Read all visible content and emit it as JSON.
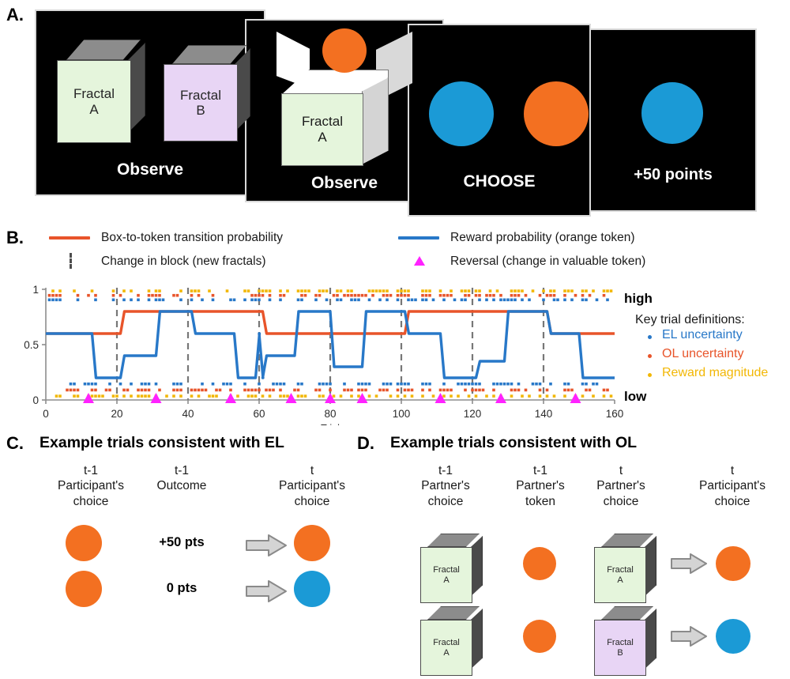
{
  "panels": {
    "a": {
      "letter": "A.",
      "screens": [
        {
          "label": "Observe",
          "cubes": [
            {
              "fractal_line1": "Fractal",
              "fractal_line2": "A",
              "face_color": "#e5f5dc"
            },
            {
              "fractal_line1": "Fractal",
              "fractal_line2": "B",
              "face_color": "#e8d5f5"
            }
          ]
        },
        {
          "label": "Observe",
          "cubes": [
            {
              "fractal_line1": "Fractal",
              "fractal_line2": "A",
              "face_color": "#e5f5dc"
            }
          ],
          "token": "orange"
        },
        {
          "label": "CHOOSE",
          "tokens": [
            "blue",
            "orange"
          ]
        },
        {
          "label": "+50 points",
          "tokens": [
            "blue"
          ]
        }
      ]
    },
    "b": {
      "letter": "B.",
      "legend": [
        {
          "id": "transition-prob",
          "type": "line",
          "color": "#e8542a",
          "label": "Box-to-token transition probability"
        },
        {
          "id": "reward-prob",
          "type": "line",
          "color": "#2878c8",
          "label": "Reward probability (orange token)"
        },
        {
          "id": "block-change",
          "type": "dash",
          "color": "#4d4d4d",
          "label": "Change in block (new fractals)"
        },
        {
          "id": "reversal",
          "type": "triangle",
          "color": "#ff22ff",
          "label": "Reversal (change in valuable token)"
        }
      ],
      "side": {
        "high": "high",
        "low": "low",
        "key_title": "Key trial definitions:",
        "items": [
          {
            "label": "EL uncertainty",
            "color": "#2878c8"
          },
          {
            "label": "OL uncertainty",
            "color": "#e8542a"
          },
          {
            "label": "Reward magnitude",
            "color": "#f2b705"
          }
        ]
      }
    },
    "c": {
      "letter": "C.",
      "title": "Example trials consistent with EL",
      "columns": [
        {
          "time": "t-1",
          "name_line1": "Participant's",
          "name_line2": "choice"
        },
        {
          "time": "t-1",
          "name_line1": "Outcome",
          "name_line2": ""
        },
        {
          "time": "t",
          "name_line1": "Participant's",
          "name_line2": "choice"
        }
      ],
      "rows": [
        {
          "prev_choice": "orange",
          "outcome": "+50 pts",
          "next_choice": "orange"
        },
        {
          "prev_choice": "orange",
          "outcome": "0 pts",
          "next_choice": "blue"
        }
      ]
    },
    "d": {
      "letter": "D.",
      "title": "Example trials consistent with OL",
      "columns": [
        {
          "time": "t-1",
          "name_line1": "Partner's",
          "name_line2": "choice"
        },
        {
          "time": "t-1",
          "name_line1": "Partner's",
          "name_line2": "token"
        },
        {
          "time": "t",
          "name_line1": "Partner's",
          "name_line2": "choice"
        },
        {
          "time": "t",
          "name_line1": "Participant's",
          "name_line2": "choice"
        }
      ],
      "rows": [
        {
          "prev_cube": {
            "fractal_line1": "Fractal",
            "fractal_line2": "A",
            "face_color": "#e5f5dc"
          },
          "prev_token": "orange",
          "cur_cube": {
            "fractal_line1": "Fractal",
            "fractal_line2": "A",
            "face_color": "#e5f5dc"
          },
          "participant_choice": "orange"
        },
        {
          "prev_cube": {
            "fractal_line1": "Fractal",
            "fractal_line2": "A",
            "face_color": "#e5f5dc"
          },
          "prev_token": "orange",
          "cur_cube": {
            "fractal_line1": "Fractal",
            "fractal_line2": "B",
            "face_color": "#e8d5f5"
          },
          "participant_choice": "blue"
        }
      ]
    }
  },
  "chart_data": {
    "type": "line",
    "title": "",
    "xlabel": "Trial",
    "ylabel": "",
    "xlim": [
      0,
      160
    ],
    "ylim": [
      0,
      1
    ],
    "xticks": [
      0,
      20,
      40,
      60,
      80,
      100,
      120,
      140,
      160
    ],
    "yticks": [
      0,
      0.5,
      1
    ],
    "grid": false,
    "legend_position": "above",
    "series": [
      {
        "name": "Box-to-token transition probability",
        "color": "#e8542a",
        "steps": [
          {
            "x": 0,
            "y": 0.6
          },
          {
            "x": 20,
            "y": 0.6
          },
          {
            "x": 21,
            "y": 0.8
          },
          {
            "x": 60,
            "y": 0.8
          },
          {
            "x": 61,
            "y": 0.6
          },
          {
            "x": 100,
            "y": 0.6
          },
          {
            "x": 101,
            "y": 0.8
          },
          {
            "x": 140,
            "y": 0.8
          },
          {
            "x": 141,
            "y": 0.6
          },
          {
            "x": 160,
            "y": 0.6
          }
        ]
      },
      {
        "name": "Reward probability (orange token)",
        "color": "#2878c8",
        "steps": [
          {
            "x": 0,
            "y": 0.6
          },
          {
            "x": 11,
            "y": 0.6
          },
          {
            "x": 13,
            "y": 0.2
          },
          {
            "x": 20,
            "y": 0.2
          },
          {
            "x": 21,
            "y": 0.4
          },
          {
            "x": 30,
            "y": 0.4
          },
          {
            "x": 31,
            "y": 0.8
          },
          {
            "x": 40,
            "y": 0.8
          },
          {
            "x": 41,
            "y": 0.6
          },
          {
            "x": 51,
            "y": 0.6
          },
          {
            "x": 52,
            "y": 0.6
          },
          {
            "x": 59,
            "y": 0.6
          },
          {
            "x": 53,
            "y": 0.2
          },
          {
            "x": 60,
            "y": 0.2
          },
          {
            "x": 61,
            "y": 0.4
          },
          {
            "x": 69,
            "y": 0.4
          },
          {
            "x": 70,
            "y": 0.8
          },
          {
            "x": 79,
            "y": 0.8
          },
          {
            "x": 80,
            "y": 0.3
          },
          {
            "x": 88,
            "y": 0.3
          },
          {
            "x": 89,
            "y": 0.8
          },
          {
            "x": 100,
            "y": 0.8
          },
          {
            "x": 101,
            "y": 0.6
          },
          {
            "x": 110,
            "y": 0.6
          },
          {
            "x": 111,
            "y": 0.2
          },
          {
            "x": 120,
            "y": 0.2
          },
          {
            "x": 121,
            "y": 0.35
          },
          {
            "x": 128,
            "y": 0.35
          },
          {
            "x": 129,
            "y": 0.8
          },
          {
            "x": 140,
            "y": 0.8
          },
          {
            "x": 141,
            "y": 0.6
          },
          {
            "x": 149,
            "y": 0.6
          },
          {
            "x": 150,
            "y": 0.2
          },
          {
            "x": 160,
            "y": 0.2
          }
        ]
      }
    ],
    "block_changes": [
      20,
      40,
      60,
      80,
      100,
      120,
      140
    ],
    "reversals": [
      12,
      31,
      52,
      69,
      80,
      89,
      111,
      128,
      149
    ],
    "trial_markers": {
      "note": "Key trial dot rasters. top group plotted near y=1, bottom group near y=0",
      "top": {
        "reward_magnitude": {
          "color": "#f2b705",
          "y": 0.985,
          "trials": [
            2,
            4,
            8,
            13,
            19,
            22,
            24,
            29,
            31,
            32,
            38,
            41,
            42,
            43,
            46,
            51,
            56,
            57,
            60,
            61,
            62,
            63,
            66,
            68,
            71,
            72,
            73,
            74,
            77,
            78,
            79,
            82,
            83,
            85,
            86,
            91,
            92,
            93,
            94,
            95,
            96,
            99,
            100,
            101,
            102,
            106,
            107,
            108,
            111,
            114,
            117,
            118,
            119,
            121,
            122,
            125,
            127,
            131,
            132,
            133,
            134,
            137,
            140,
            142,
            143,
            146,
            147,
            148,
            151,
            152,
            154,
            157,
            158,
            159
          ]
        },
        "ol_uncertainty": {
          "color": "#e8542a",
          "y": 0.945,
          "trials": [
            1,
            2,
            3,
            4,
            9,
            12,
            14,
            19,
            21,
            26,
            29,
            30,
            31,
            32,
            36,
            37,
            41,
            43,
            47,
            58,
            59,
            60,
            61,
            63,
            66,
            67,
            72,
            73,
            76,
            77,
            81,
            82,
            84,
            85,
            86,
            87,
            88,
            89,
            90,
            92,
            95,
            96,
            97,
            99,
            100,
            101,
            102,
            106,
            107,
            108,
            111,
            112,
            113,
            114,
            118,
            119,
            121,
            122,
            124,
            125,
            126,
            128,
            131,
            132,
            133,
            135,
            139,
            141,
            142,
            143,
            146,
            149,
            151,
            153,
            157
          ]
        },
        "el_uncertainty": {
          "color": "#2878c8",
          "y": 0.905,
          "trials": [
            1,
            2,
            3,
            4,
            9,
            14,
            19,
            22,
            24,
            26,
            29,
            31,
            32,
            33,
            38,
            41,
            44,
            47,
            52,
            53,
            56,
            58,
            59,
            60,
            63,
            66,
            71,
            72,
            76,
            79,
            82,
            83,
            86,
            87,
            88,
            91,
            94,
            96,
            99,
            102,
            103,
            104,
            106,
            107,
            109,
            112,
            115,
            117,
            118,
            122,
            124,
            126,
            128,
            129,
            130,
            131,
            132,
            134,
            136,
            140,
            143,
            144,
            146,
            148,
            151,
            152,
            155,
            158
          ]
        }
      },
      "bottom": {
        "el_uncertainty": {
          "color": "#2878c8",
          "y": 0.145,
          "trials": [
            7,
            8,
            11,
            12,
            13,
            14,
            18,
            21,
            24,
            27,
            28,
            29,
            31,
            36,
            37,
            38,
            44,
            47,
            50,
            51,
            52,
            56,
            60,
            64,
            65,
            66,
            67,
            71,
            72,
            77,
            78,
            79,
            80,
            84,
            88,
            89,
            90,
            91,
            95,
            96,
            97,
            99,
            100,
            101,
            102,
            106,
            107,
            108,
            112,
            116,
            117,
            118,
            119,
            120,
            121,
            122,
            126,
            127,
            128,
            129,
            130,
            131,
            133,
            137,
            138,
            139,
            142,
            146,
            147,
            151,
            152,
            154,
            155
          ]
        },
        "ol_uncertainty": {
          "color": "#e8542a",
          "y": 0.09,
          "trials": [
            6,
            7,
            8,
            9,
            13,
            14,
            17,
            18,
            22,
            23,
            26,
            27,
            28,
            29,
            32,
            36,
            37,
            38,
            41,
            42,
            43,
            44,
            45,
            48,
            49,
            52,
            56,
            57,
            58,
            59,
            60,
            62,
            63,
            64,
            66,
            70,
            71,
            76,
            77,
            80,
            84,
            85,
            86,
            88,
            89,
            90,
            94,
            95,
            96,
            99,
            101,
            102,
            103,
            106,
            108,
            111,
            112,
            113,
            114,
            118,
            120,
            121,
            122,
            123,
            126,
            131,
            132,
            133,
            135,
            139,
            141,
            146,
            147,
            148,
            152,
            153,
            157,
            158
          ]
        },
        "reward_magnitude": {
          "color": "#f2b705",
          "y": 0.035,
          "trials": [
            3,
            4,
            8,
            9,
            12,
            13,
            14,
            15,
            16,
            19,
            20,
            22,
            24,
            26,
            27,
            28,
            29,
            31,
            34,
            36,
            38,
            41,
            43,
            46,
            47,
            48,
            52,
            54,
            57,
            58,
            59,
            61,
            63,
            66,
            67,
            68,
            71,
            72,
            73,
            77,
            78,
            81,
            83,
            86,
            88,
            91,
            93,
            97,
            99,
            101,
            103,
            106,
            109,
            112,
            114,
            116,
            119,
            121,
            124,
            126,
            128,
            131,
            134,
            136,
            139,
            141,
            143,
            146,
            149,
            151,
            154,
            157,
            159
          ]
        }
      }
    }
  }
}
